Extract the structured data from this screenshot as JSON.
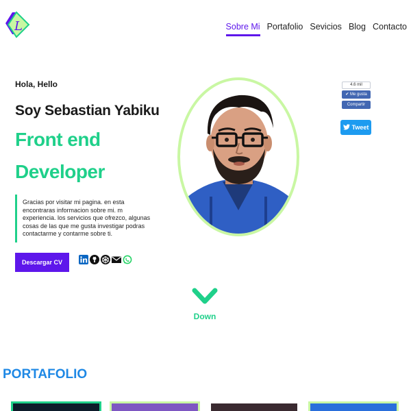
{
  "colors": {
    "accent": "#5e17eb",
    "green": "#1fd08a",
    "light_green": "#c9f7a3",
    "section_blue": "#1e88e5"
  },
  "logo": {
    "letter": "L"
  },
  "nav": {
    "items": [
      {
        "label": "Sobre Mi",
        "active": true
      },
      {
        "label": "Portafolio"
      },
      {
        "label": "Sevicios"
      },
      {
        "label": "Blog"
      },
      {
        "label": "Contacto"
      }
    ]
  },
  "hero": {
    "greeting": "Hola, Hello",
    "name": "Soy Sebastian Yabiku",
    "role_line1": "Front end",
    "role_line2": "Developer",
    "intro": "Gracias por visitar mi pagina. en esta encontraras informacion sobre mi. m experiencia. los servicios que ofrezco, algunas cosas de las que me gusta investigar podras contactarme y contarme sobre ti.",
    "cv_button": "Descargar CV",
    "social_icons": [
      "linkedin-icon",
      "github-icon",
      "website-icon",
      "email-icon",
      "whatsapp-icon"
    ]
  },
  "social_widgets": {
    "like_count": "4.6 mil",
    "like_label": "Me gusta",
    "share_label": "Compartir",
    "tweet_label": "Tweet"
  },
  "down": {
    "label": "Down"
  },
  "portfolio": {
    "title": "PORTAFOLIO"
  }
}
